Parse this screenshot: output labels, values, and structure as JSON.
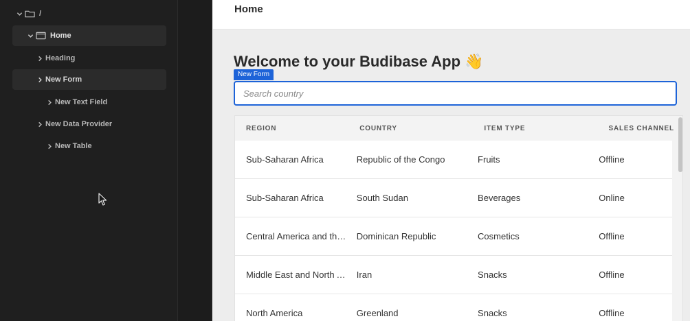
{
  "tree": {
    "root": {
      "label": "/"
    },
    "items": [
      {
        "label": "Home",
        "kind": "screen"
      },
      {
        "label": "Heading"
      },
      {
        "label": "New Form"
      },
      {
        "label": "New Text Field"
      },
      {
        "label": "New Data Provider"
      },
      {
        "label": "New Table"
      }
    ]
  },
  "preview": {
    "breadcrumb": "Home",
    "title": "Welcome to your Budibase App 👋",
    "form_tag": "New Form",
    "search": {
      "placeholder": "Search country",
      "value": ""
    },
    "table": {
      "headers": [
        "REGION",
        "COUNTRY",
        "ITEM TYPE",
        "SALES CHANNEL"
      ],
      "rows": [
        [
          "Sub-Saharan Africa",
          "Republic of the Congo",
          "Fruits",
          "Offline"
        ],
        [
          "Sub-Saharan Africa",
          "South Sudan",
          "Beverages",
          "Online"
        ],
        [
          "Central America and the Caribbean",
          "Dominican Republic",
          "Cosmetics",
          "Offline"
        ],
        [
          "Middle East and North Africa",
          "Iran",
          "Snacks",
          "Offline"
        ],
        [
          "North America",
          "Greenland",
          "Snacks",
          "Offline"
        ]
      ]
    }
  },
  "colors": {
    "accent": "#1d63d8",
    "panel_bg": "#1f1f1f",
    "selected_row": "#2b2b2b"
  }
}
